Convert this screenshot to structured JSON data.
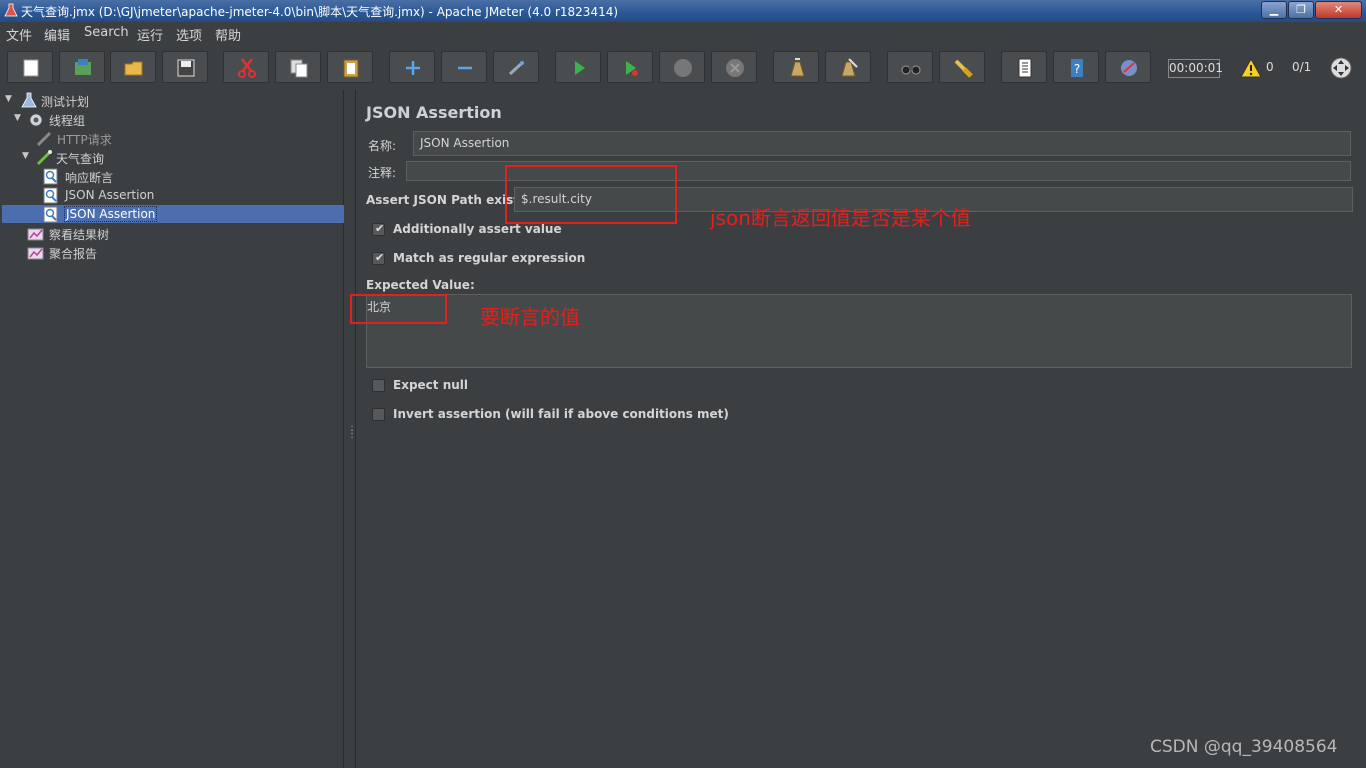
{
  "window": {
    "title": "天气查询.jmx (D:\\GJ\\jmeter\\apache-jmeter-4.0\\bin\\脚本\\天气查询.jmx) - Apache JMeter (4.0 r1823414)",
    "min_label": "▁",
    "max_label": "❐",
    "close_label": "✕"
  },
  "menu": [
    "文件",
    "编辑",
    "Search",
    "运行",
    "选项",
    "帮助"
  ],
  "toolbar": {
    "buttons": [
      "new-icon",
      "templates-icon",
      "open-icon",
      "save-icon",
      "cut-icon",
      "copy-icon",
      "paste-icon",
      "expand-icon",
      "collapse-icon",
      "toggle-icon",
      "start-icon",
      "start-no-pause-icon",
      "stop-icon",
      "shutdown-icon",
      "clear-icon",
      "clear-all-icon",
      "search-icon",
      "reset-search-icon",
      "function-helper-icon",
      "help-icon",
      "remote-icon"
    ],
    "timer": "00:00:01",
    "warning_count": "0",
    "threads": "0/1"
  },
  "tree": [
    {
      "label": "测试计划",
      "icon": "test-plan-icon",
      "toggle": "▼"
    },
    {
      "label": "线程组",
      "icon": "thread-group-icon",
      "toggle": "▼"
    },
    {
      "label": "HTTP请求",
      "icon": "http-sampler-icon",
      "toggle": ""
    },
    {
      "label": "天气查询",
      "icon": "sampler-icon",
      "toggle": "▼"
    },
    {
      "label": "响应断言",
      "icon": "assertion-icon",
      "toggle": ""
    },
    {
      "label": "JSON Assertion",
      "icon": "assertion-icon",
      "toggle": ""
    },
    {
      "label": "JSON Assertion",
      "icon": "assertion-icon",
      "toggle": ""
    },
    {
      "label": "察看结果树",
      "icon": "listener-icon",
      "toggle": ""
    },
    {
      "label": "聚合报告",
      "icon": "listener-icon",
      "toggle": ""
    }
  ],
  "panel": {
    "title": "JSON Assertion",
    "name_label": "名称:",
    "name_value": "JSON Assertion",
    "comment_label": "注释:",
    "comment_value": "",
    "json_path_label": "Assert JSON Path exists:",
    "json_path_value": "$.result.city",
    "additionally_assert_label": "Additionally assert value",
    "additionally_assert_checked": true,
    "regex_label": "Match as regular expression",
    "regex_checked": true,
    "expected_label": "Expected Value:",
    "expected_value": "北京",
    "expect_null_label": "Expect null",
    "expect_null_checked": false,
    "invert_label": "Invert assertion (will fail if above conditions met)",
    "invert_checked": false,
    "check_mark": "✔"
  },
  "annotations": {
    "json_path_note": "json断言返回值是否是某个值",
    "expected_note": "要断言的值",
    "color": "#e3211c"
  },
  "watermark": "CSDN @qq_39408564"
}
